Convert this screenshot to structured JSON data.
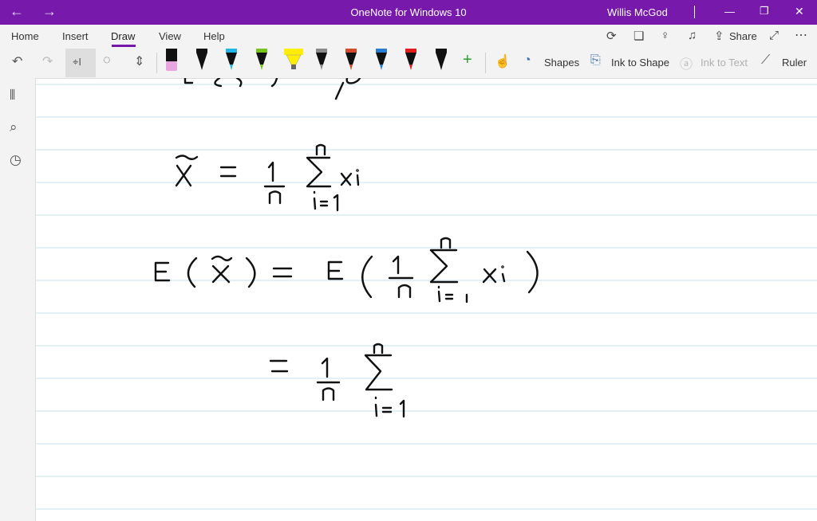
{
  "window": {
    "title": "OneNote for Windows 10",
    "user": "Willis McGod",
    "back_glyph": "←",
    "forward_glyph": "→",
    "minimize_glyph": "—",
    "restore_glyph": "❐",
    "close_glyph": "✕"
  },
  "ribbon": {
    "tabs": [
      {
        "label": "Home"
      },
      {
        "label": "Insert"
      },
      {
        "label": "Draw"
      },
      {
        "label": "View"
      },
      {
        "label": "Help"
      }
    ],
    "active_tab": "Draw",
    "share_label": "Share",
    "more_glyph": "⋯"
  },
  "toolbar": {
    "shapes_label": "Shapes",
    "ink_to_shape_label": "Ink to Shape",
    "ink_to_text_label": "Ink to Text",
    "ruler_label": "Ruler",
    "add_pen_glyph": "+",
    "pens": [
      {
        "name": "eraser",
        "color": "#e8a6e0"
      },
      {
        "name": "pen-black",
        "color": "#111111"
      },
      {
        "name": "pen-cyan",
        "color": "#22b5e8"
      },
      {
        "name": "pen-green",
        "color": "#77c51b"
      },
      {
        "name": "highlighter-yellow",
        "color": "#ffee00"
      },
      {
        "name": "pen-gray",
        "color": "#8a8a8a"
      },
      {
        "name": "pen-galaxy",
        "color": "#d44a2a"
      },
      {
        "name": "pen-blue-galaxy",
        "color": "#2a7bd4"
      },
      {
        "name": "pen-red",
        "color": "#e21b1b"
      },
      {
        "name": "pen-black-2",
        "color": "#111111"
      }
    ]
  },
  "colors": {
    "accent": "#7719aa",
    "ruled_line": "#c5e1f0",
    "margin_line": "#e8c8c8"
  },
  "ink": {
    "line1": "E(x) = μ",
    "line2": "X̄ = 1/n Σ(i=1 to n) xi",
    "line3": "E(X̄) = E(1/n Σ(i=1 to n) xi)",
    "line4": "= 1/n Σ(i=1 to n)"
  }
}
